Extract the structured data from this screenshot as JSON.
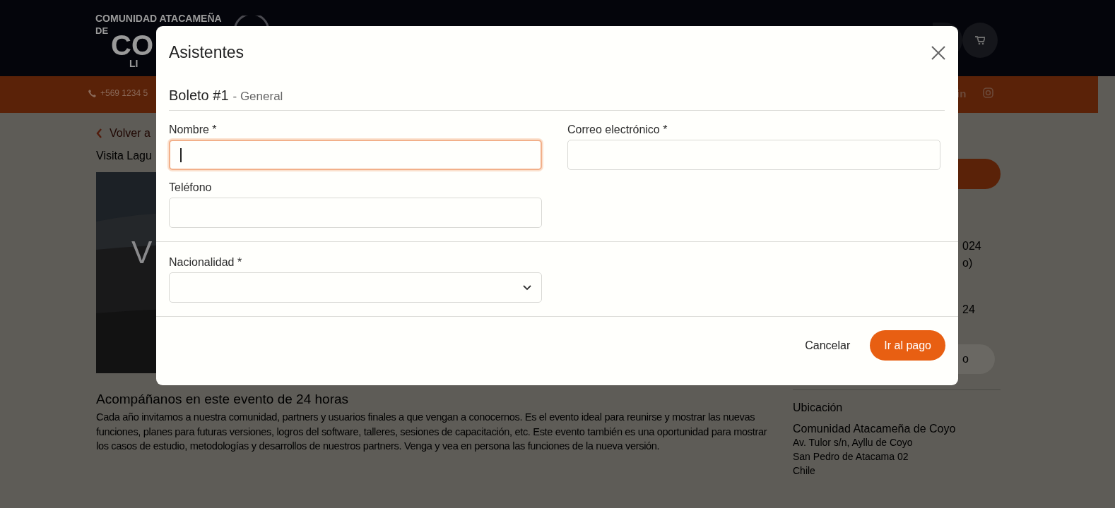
{
  "header": {
    "logo": [
      "COMUNIDAD ATACAMEÑA",
      "DE",
      "CO",
      "LI"
    ]
  },
  "top_bar": {
    "phone": "+569 1234 5",
    "social_icon": "in"
  },
  "page": {
    "back_link": "Volver a",
    "event_title": "Visita Lagu",
    "image_caption": "V",
    "heading": "Acompáñanos en este evento de 24 horas",
    "description": "Cada año invitamos a nuestra comunidad, partners y usuarios finales a que vengan a conocernos. Es el evento ideal para reunirse y mostrar las nuevas funciones, planes para futuras versiones, logros del software, talleres, sesiones de capacitación, etc. Este evento también es una oportunidad para mostrar los casos de estudio, metodologías y desarrollos de nuestros partners. Venga y vea en persona las funciones de la nueva versión.",
    "sidebar_fragments": [
      "024",
      "o)",
      "24"
    ],
    "sidebar_button": "o",
    "location": {
      "title": "Ubicación",
      "name": "Comunidad Atacameña de Coyo",
      "address_lines": [
        "Av. Tulor s/n, Ayllu de Coyo",
        "San Pedro de Atacama 02",
        "Chile"
      ]
    }
  },
  "dialog": {
    "title": "Asistentes",
    "ticket": {
      "number": "Boleto #1",
      "type": "- General"
    },
    "sections": [
      [
        {
          "label": "Nombre *",
          "kind": "text",
          "focused": true
        },
        {
          "label": "Correo electrónico *",
          "kind": "text",
          "focused": false
        },
        {
          "label": "Teléfono",
          "kind": "text",
          "focused": false
        }
      ],
      [
        {
          "label": "Nacionalidad *",
          "kind": "select",
          "focused": false
        }
      ]
    ],
    "buttons": [
      {
        "label": "Cancelar",
        "kind": "text"
      },
      {
        "label": "Ir al pago",
        "kind": "primary"
      }
    ]
  }
}
